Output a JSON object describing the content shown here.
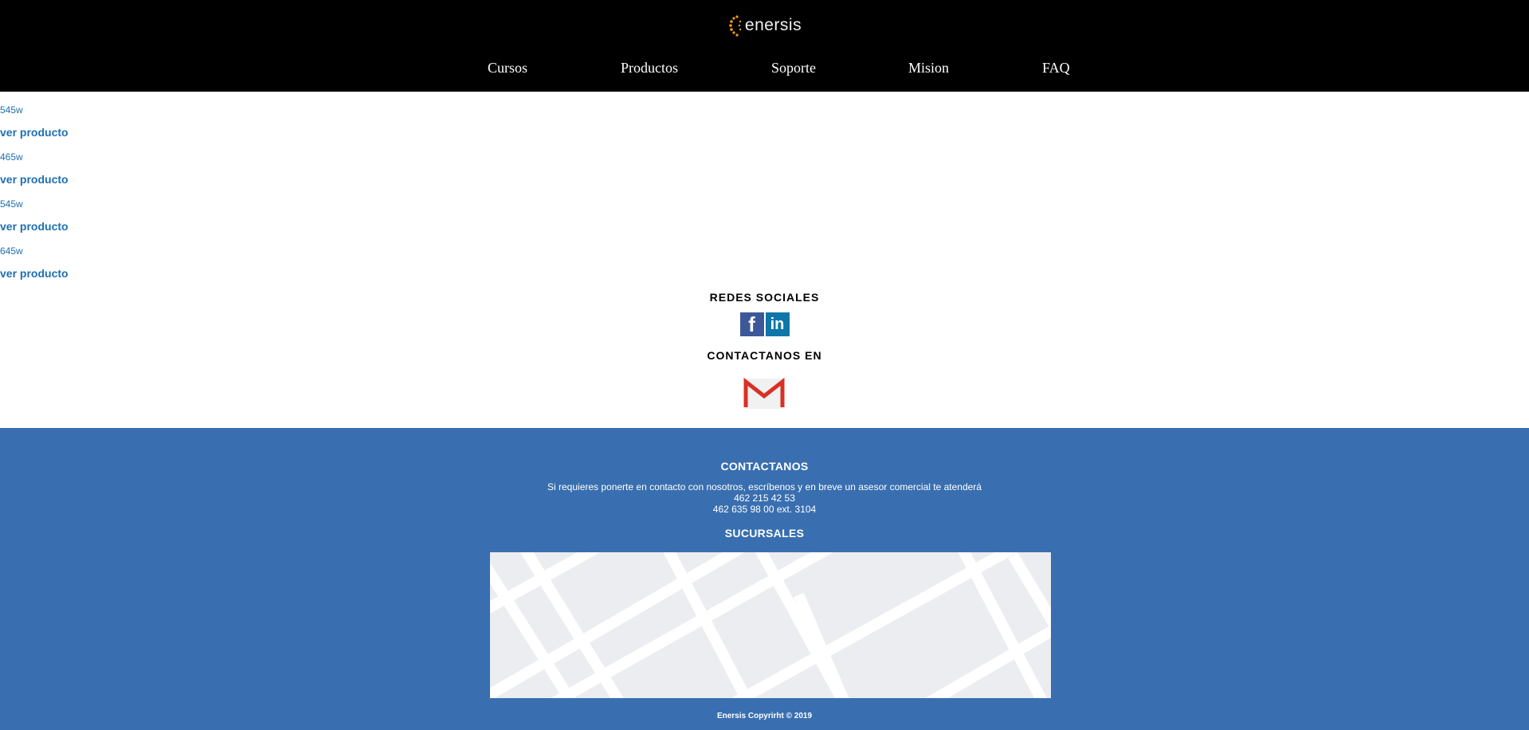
{
  "header": {
    "logo_text": "enersis",
    "nav": [
      {
        "label": "Cursos"
      },
      {
        "label": "Productos"
      },
      {
        "label": "Soporte"
      },
      {
        "label": "Mision"
      },
      {
        "label": "FAQ"
      }
    ]
  },
  "products": [
    {
      "power": "545w",
      "link": "ver producto"
    },
    {
      "power": "465w",
      "link": "ver producto"
    },
    {
      "power": "545w",
      "link": "ver producto"
    },
    {
      "power": "645w",
      "link": "ver producto"
    }
  ],
  "social": {
    "title": "REDES SOCIALES",
    "contact_title": "CONTACTANOS EN",
    "facebook_icon": "facebook-icon",
    "linkedin_icon": "linkedin-icon",
    "gmail_icon": "gmail-icon"
  },
  "footer": {
    "title": "CONTACTANOS",
    "message": "Si requieres ponerte en contacto con nosotros, escríbenos y en breve un asesor comercial te atenderá",
    "phone1": "462 215 42 53",
    "phone2": "462 635 98 00 ext. 3104",
    "branches_title": "SUCURSALES",
    "copyright": "Enersis Copyrirht © 2019"
  },
  "colors": {
    "header_bg": "#000000",
    "link": "#1f6fb2",
    "footer_bg": "#396fb0",
    "map_bg": "#ecedf0"
  }
}
